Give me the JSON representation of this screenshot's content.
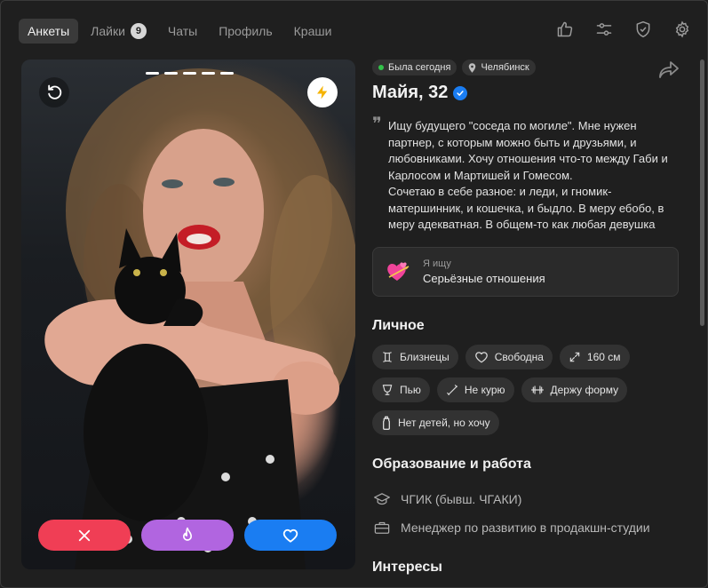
{
  "nav": {
    "tabs": [
      {
        "label": "Анкеты",
        "active": true
      },
      {
        "label": "Лайки",
        "badge": "9"
      },
      {
        "label": "Чаты"
      },
      {
        "label": "Профиль"
      },
      {
        "label": "Краши"
      }
    ],
    "icons": [
      "thumbs-up-icon",
      "sliders-icon",
      "shield-check-icon",
      "gear-icon"
    ]
  },
  "photo": {
    "photo_count": 5,
    "icons": {
      "undo": "undo-icon",
      "boost": "lightning-icon"
    },
    "actions": [
      {
        "name": "dislike",
        "icon": "close-icon",
        "color": "#f03e55"
      },
      {
        "name": "super-like",
        "icon": "flame-icon",
        "color": "#b165e0"
      },
      {
        "name": "like",
        "icon": "heart-icon",
        "color": "#1a7df2"
      }
    ]
  },
  "profile": {
    "status": "Была сегодня",
    "city": "Челябинск",
    "name": "Майя, 32",
    "verified": true,
    "bio": "Ищу будущего \"соседа по могиле\". Мне нужен партнер, с которым можно быть и друзьями, и любовниками. Хочу отношения что-то между Габи и Карлосом и Мартишей и Гомесом.\nСочетаю в себе разное: и леди, и гномик-матершинник, и кошечка, и быдло. В меру ебобо, в меру адекватная. В общем-то как любая девушка",
    "seeking": {
      "title": "Я ищу",
      "value": "Серьёзные отношения"
    },
    "personal": {
      "title": "Личное",
      "tags": [
        {
          "icon": "gemini-icon",
          "label": "Близнецы"
        },
        {
          "icon": "heart-outline-icon",
          "label": "Свободна"
        },
        {
          "icon": "height-icon",
          "label": "160 см"
        },
        {
          "icon": "glass-icon",
          "label": "Пью"
        },
        {
          "icon": "no-smoking-icon",
          "label": "Не курю"
        },
        {
          "icon": "dumbbell-icon",
          "label": "Держу форму"
        },
        {
          "icon": "baby-bottle-icon",
          "label": "Нет детей, но хочу"
        }
      ]
    },
    "education": {
      "title": "Образование и работа",
      "items": [
        {
          "icon": "graduation-cap-icon",
          "label": "ЧГИК (бывш. ЧГАКИ)"
        },
        {
          "icon": "briefcase-icon",
          "label": "Менеджер по развитию в продакшн-студии"
        }
      ]
    },
    "next_section": "Интересы"
  }
}
